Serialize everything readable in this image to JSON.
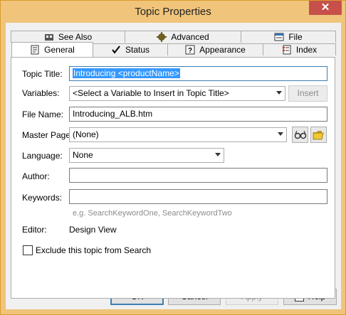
{
  "window": {
    "title": "Topic Properties",
    "close_glyph": "✕"
  },
  "tabs": {
    "back_row": [
      {
        "label": "See Also",
        "icon": "see-also-icon"
      },
      {
        "label": "Advanced",
        "icon": "gear-icon"
      },
      {
        "label": "File",
        "icon": "file-icon"
      }
    ],
    "front_row": [
      {
        "label": "General",
        "icon": "general-icon",
        "active": true
      },
      {
        "label": "Status",
        "icon": "checkmark-icon"
      },
      {
        "label": "Appearance",
        "icon": "question-icon"
      },
      {
        "label": "Index",
        "icon": "index-icon"
      }
    ]
  },
  "form": {
    "topic_title_label": "Topic Title:",
    "topic_title_value": "Introducing <productName>",
    "variables_label": "Variables:",
    "variables_value": "<Select a Variable to Insert in Topic Title>",
    "insert_label": "Insert",
    "file_name_label": "File Name:",
    "file_name_value": "Introducing_ALB.htm",
    "master_page_label": "Master Page:",
    "master_page_value": "(None)",
    "language_label": "Language:",
    "language_value": "None",
    "author_label": "Author:",
    "author_value": "",
    "keywords_label": "Keywords:",
    "keywords_value": "",
    "keywords_hint": "e.g. SearchKeywordOne, SearchKeywordTwo",
    "editor_label": "Editor:",
    "editor_value": "Design View",
    "exclude_label": "Exclude this topic from Search",
    "exclude_checked": false
  },
  "buttons": {
    "ok": "OK",
    "cancel": "Cancel",
    "apply": "Apply",
    "help": "Help"
  }
}
